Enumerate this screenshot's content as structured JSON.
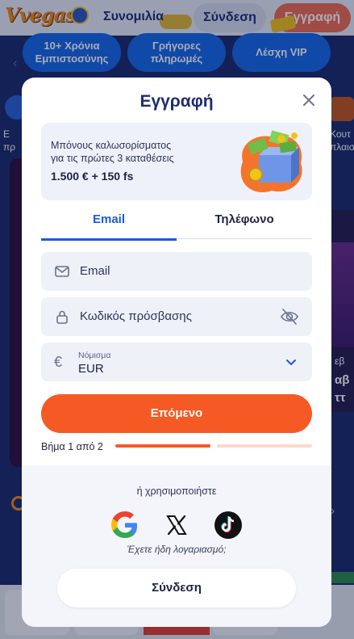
{
  "header": {
    "logo_text": "Vvegas",
    "chat_link": "Συνομιλία",
    "login_label": "Σύνδεση",
    "register_label": "Εγγραφή"
  },
  "promo_pills": [
    {
      "label": "10+ Χρόνια Εμπιστοσύνης"
    },
    {
      "label": "Γρήγορες πληρωμές"
    },
    {
      "label": "Λέσχη VIP"
    }
  ],
  "background": {
    "left_side_text": "Ε\nπρ",
    "right_side_text": "Κουτ\nπλαισ",
    "right_card_small": "εβ",
    "right_card_line1": "αβ",
    "right_card_line2": "ττ"
  },
  "modal": {
    "title": "Εγγραφή",
    "bonus": {
      "line1": "Μπόνους καλωσορίσματος",
      "line2": "για τις πρώτες 3 καταθέσεις",
      "amount": "1.500 € + 150 fs"
    },
    "tabs": [
      {
        "label": "Email",
        "active": true
      },
      {
        "label": "Τηλέφωνο",
        "active": false
      }
    ],
    "email_placeholder": "Email",
    "password_placeholder": "Κωδικός πρόσβασης",
    "currency": {
      "label": "Νόμισμα",
      "value": "EUR",
      "symbol": "€"
    },
    "next_button": "Επόμενο",
    "step_text": "Βήμα 1 από 2",
    "step_progress": 0.5,
    "or_use": "ή χρησιμοποιήστε",
    "social_icons": [
      "google-icon",
      "x-icon",
      "tiktok-icon"
    ],
    "have_account": "Έχετε ήδη λογαριασμό;",
    "login_button": "Σύνδεση"
  },
  "colors": {
    "accent_orange": "#f55a24",
    "brand_blue": "#1468e8",
    "tab_active_blue": "#1a5bd6",
    "title_navy": "#1d2d6e"
  }
}
